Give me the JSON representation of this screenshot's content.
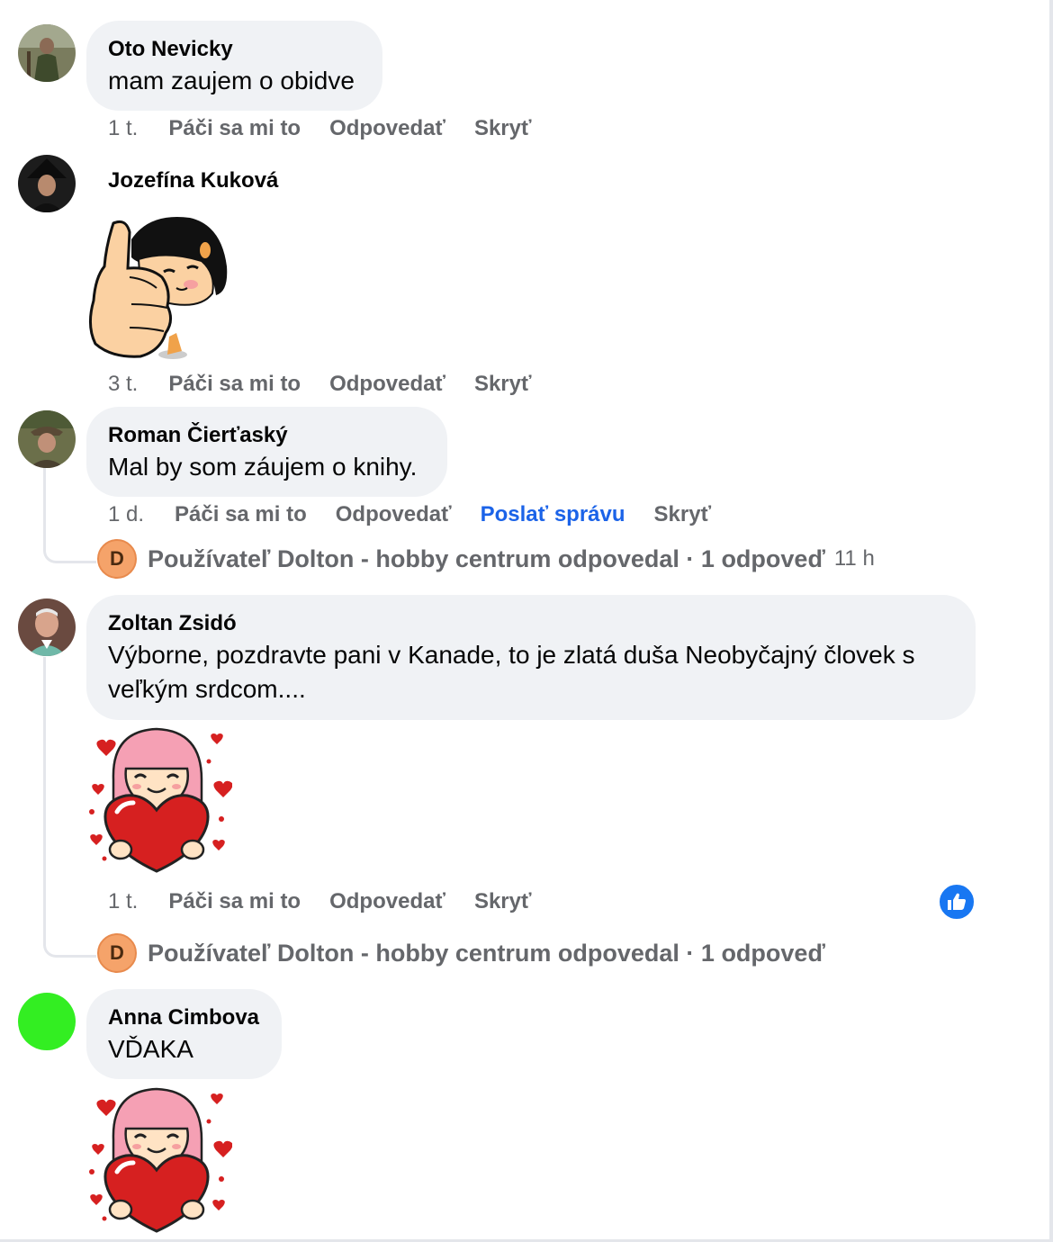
{
  "comments": [
    {
      "author": "Oto Nevicky",
      "text": "mam zaujem o obidve",
      "time": "1 t.",
      "actions": [
        "Páči sa mi to",
        "Odpovedať",
        "Skryť"
      ]
    },
    {
      "author": "Jozefína Kuková",
      "text": "",
      "time": "3 t.",
      "actions": [
        "Páči sa mi to",
        "Odpovedať",
        "Skryť"
      ],
      "sticker": "thumbs-up-girl-sticker"
    },
    {
      "author": "Roman Čierťaský",
      "text": "Mal by som záujem o knihy.",
      "time": "1 d.",
      "actions": [
        "Páči sa mi to",
        "Odpovedať",
        "Poslať správu",
        "Skryť"
      ],
      "reply_summary": {
        "avatar_letter": "D",
        "text": "Používateľ Dolton - hobby centrum odpovedal · 1 odpoveď",
        "time": "11 h"
      }
    },
    {
      "author": "Zoltan Zsidó",
      "text": "Výborne, pozdravte pani v Kanade, to je zlatá duša Neobyčajný človek s veľkým srdcom....",
      "time": "1 t.",
      "actions": [
        "Páči sa mi to",
        "Odpovedať",
        "Skryť"
      ],
      "sticker": "heart-girl-sticker",
      "reaction": "like-icon",
      "reply_summary": {
        "avatar_letter": "D",
        "text": "Používateľ Dolton - hobby centrum odpovedal · 1 odpoveď"
      }
    },
    {
      "author": "Anna Cimbova",
      "text": "VĎAKA",
      "sticker": "heart-girl-sticker"
    }
  ],
  "colors": {
    "bubble": "#f0f2f5",
    "secondary_text": "#65676b",
    "link_blue": "#1b63e8",
    "like_blue": "#1877f2",
    "anna_avatar": "#33ee22"
  }
}
